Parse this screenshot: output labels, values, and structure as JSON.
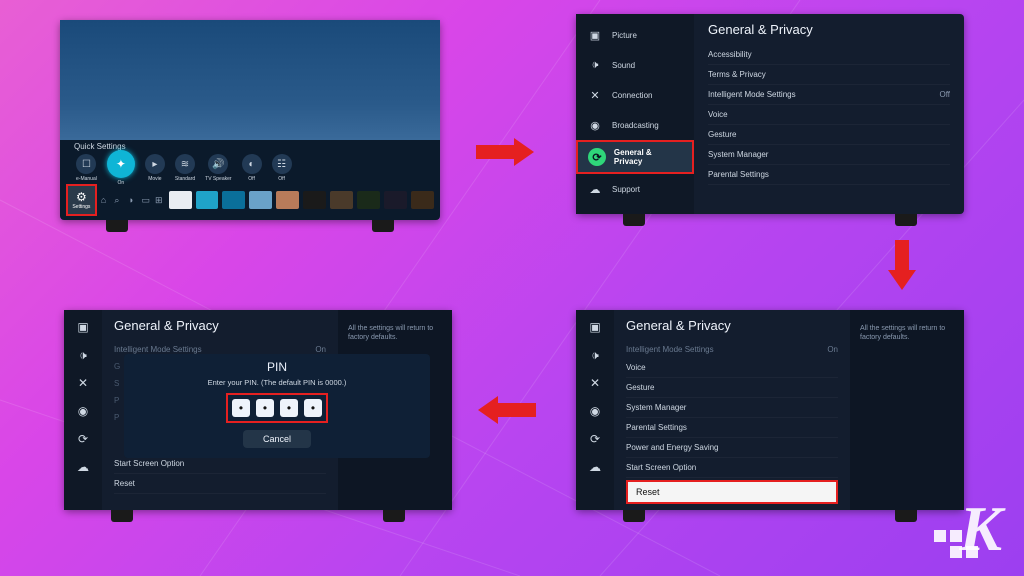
{
  "tv1": {
    "quick_settings_label": "Quick Settings",
    "dock": [
      {
        "label": "e-Manual"
      },
      {
        "label": "On",
        "featured": true
      },
      {
        "label": "Movie"
      },
      {
        "label": "Standard"
      },
      {
        "label": "TV Speaker"
      },
      {
        "label": "Off"
      },
      {
        "label": "Off"
      }
    ],
    "settings_label": "Settings"
  },
  "tv2": {
    "title": "General & Privacy",
    "nav": [
      {
        "label": "Picture"
      },
      {
        "label": "Sound"
      },
      {
        "label": "Connection"
      },
      {
        "label": "Broadcasting"
      },
      {
        "label": "General & Privacy",
        "selected": true
      },
      {
        "label": "Support"
      }
    ],
    "items": [
      {
        "label": "Accessibility"
      },
      {
        "label": "Terms & Privacy"
      },
      {
        "label": "Intelligent Mode Settings",
        "value": "Off"
      },
      {
        "label": "Voice"
      },
      {
        "label": "Gesture"
      },
      {
        "label": "System Manager"
      },
      {
        "label": "Parental Settings"
      }
    ]
  },
  "tv3": {
    "title": "General & Privacy",
    "help": "All the settings will return to factory defaults.",
    "dim_row": {
      "label": "Intelligent Mode Settings",
      "value": "On"
    },
    "items": [
      {
        "label": "Voice"
      },
      {
        "label": "Gesture"
      },
      {
        "label": "System Manager"
      },
      {
        "label": "Parental Settings"
      },
      {
        "label": "Power and Energy Saving"
      },
      {
        "label": "Start Screen Option"
      }
    ],
    "reset_label": "Reset"
  },
  "tv4": {
    "title": "General & Privacy",
    "help": "All the settings will return to factory defaults.",
    "dim_row": {
      "label": "Intelligent Mode Settings",
      "value": "On"
    },
    "pin": {
      "title": "PIN",
      "help": "Enter your PIN. (The default PIN is 0000.)",
      "cancel": "Cancel",
      "digits": [
        "•",
        "•",
        "•",
        "•"
      ]
    },
    "items_below": [
      {
        "label": "Start Screen Option"
      },
      {
        "label": "Reset"
      }
    ]
  },
  "thumbs": [
    "#e9edf2",
    "#1fa3c9",
    "#0a6f9a",
    "#6aa2c9",
    "#b87b5a",
    "#1a1a1a",
    "#4a3a2a",
    "#1a2a1a",
    "#1a1a2a",
    "#3a2a1a"
  ]
}
